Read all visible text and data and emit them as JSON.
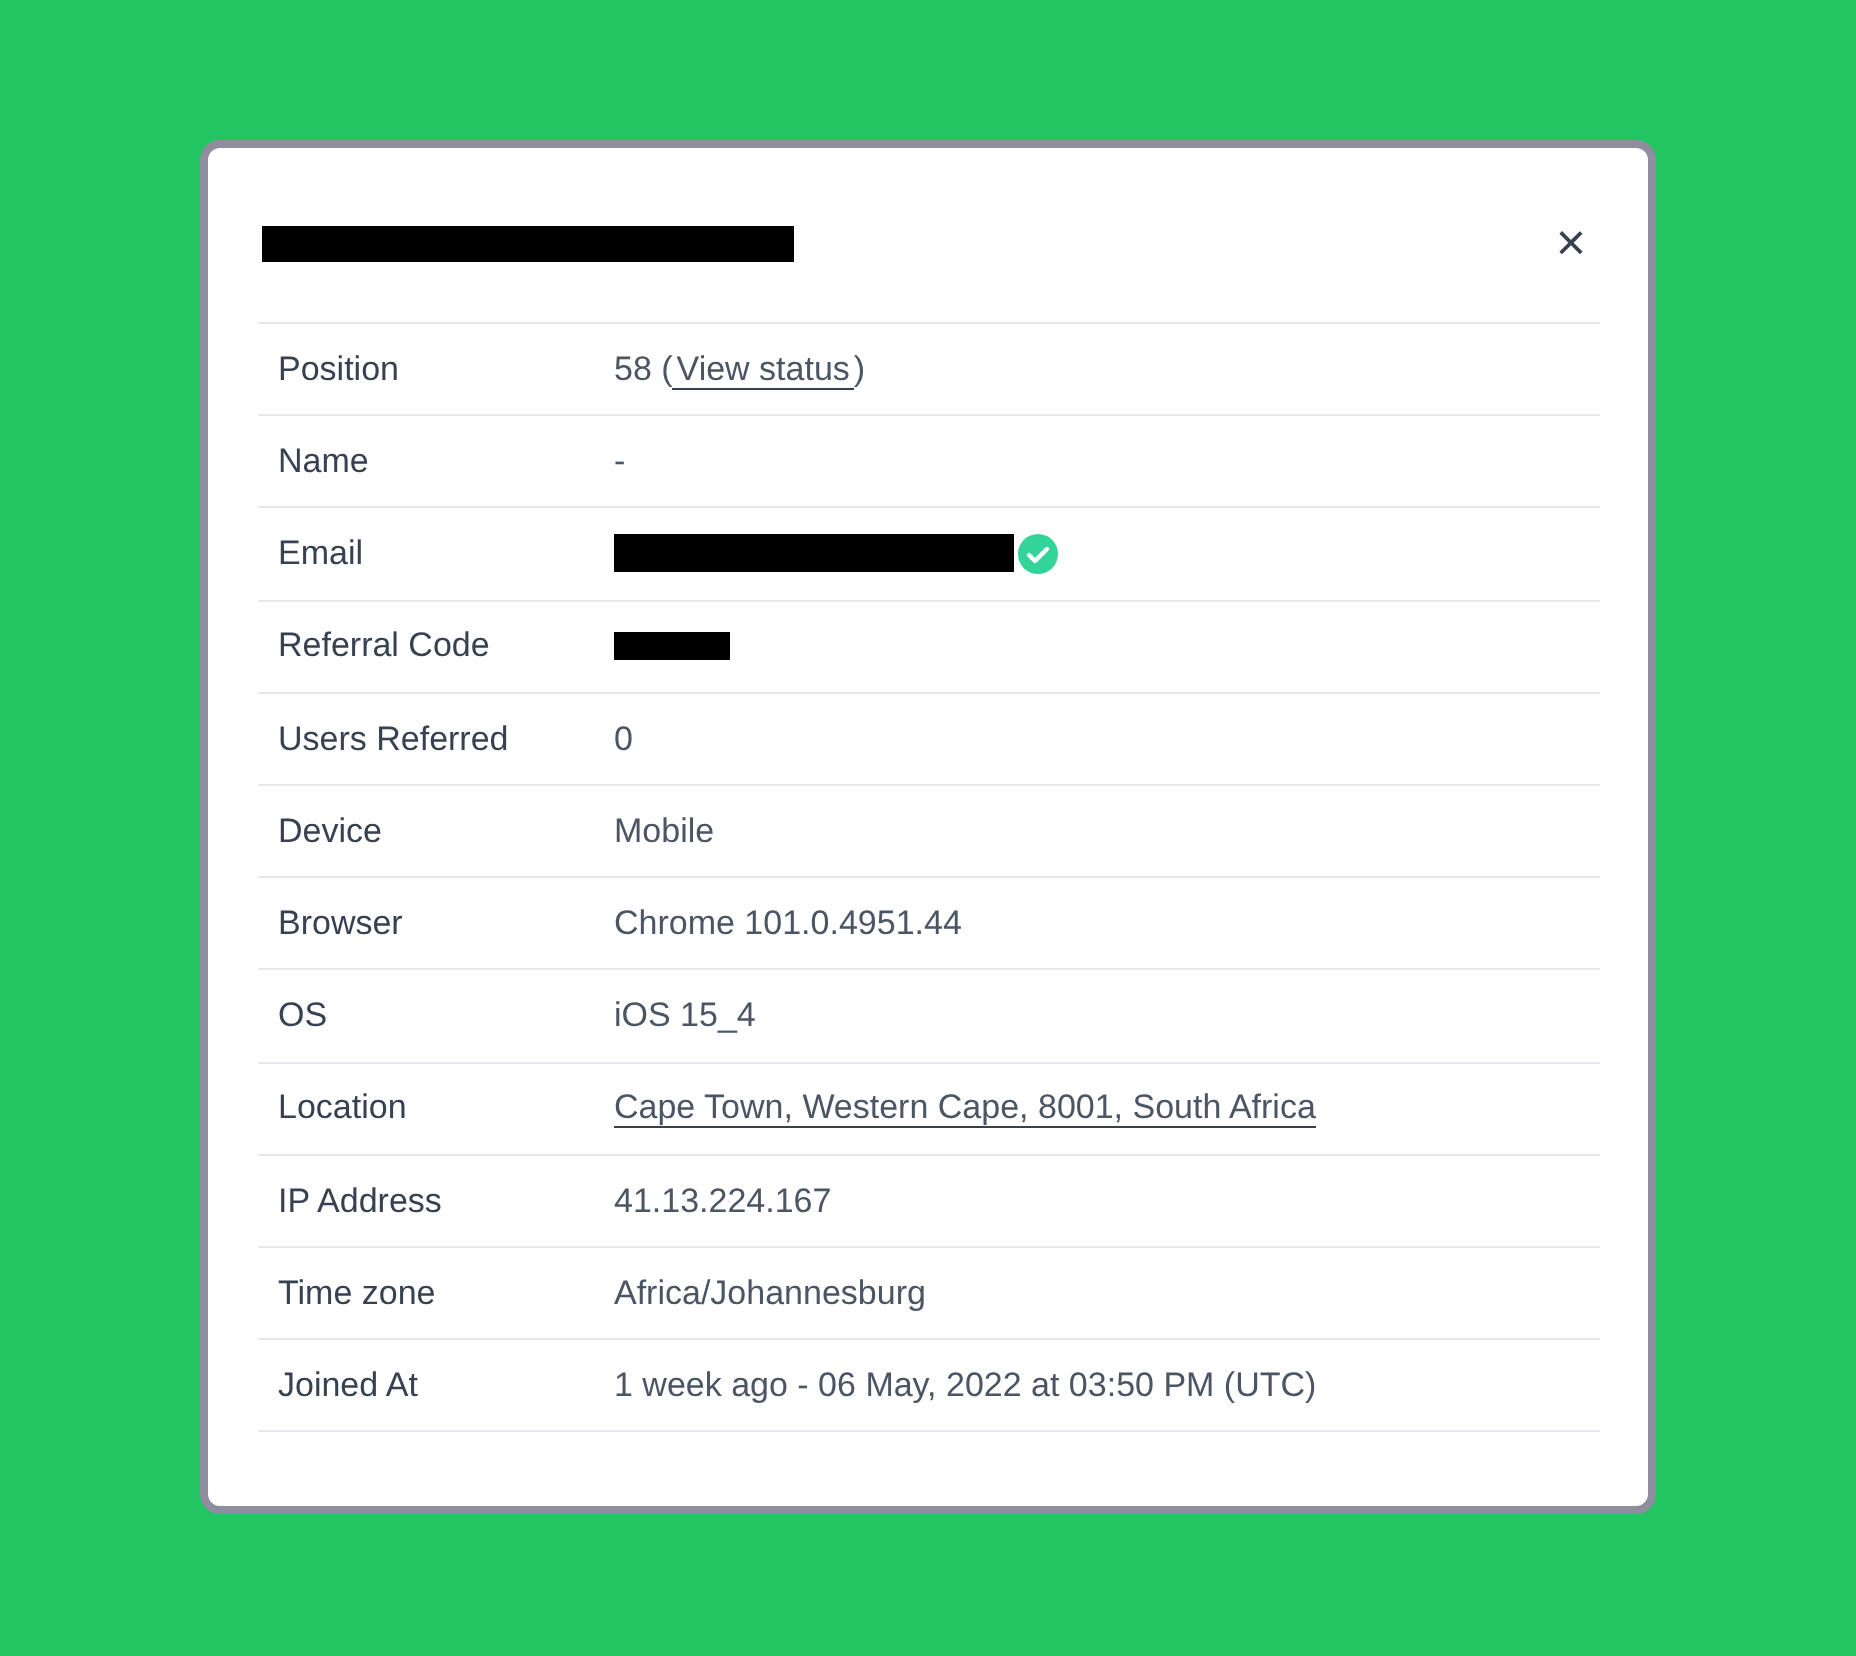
{
  "dialog": {
    "title": {
      "kind": "redacted"
    },
    "close": "×",
    "rows": [
      {
        "label": "Position",
        "kind": "position",
        "prefix": "58 (",
        "link": "View status",
        "suffix": ")"
      },
      {
        "label": "Name",
        "kind": "text",
        "value": "-"
      },
      {
        "label": "Email",
        "kind": "redacted",
        "verified": true
      },
      {
        "label": "Referral Code",
        "kind": "redacted",
        "verified": false
      },
      {
        "label": "Users Referred",
        "kind": "text",
        "value": "0"
      },
      {
        "label": "Device",
        "kind": "text",
        "value": "Mobile"
      },
      {
        "label": "Browser",
        "kind": "text",
        "value": "Chrome 101.0.4951.44"
      },
      {
        "label": "OS",
        "kind": "text",
        "value": "iOS 15_4"
      },
      {
        "label": "Location",
        "kind": "link",
        "value": "Cape Town, Western Cape, 8001, South Africa"
      },
      {
        "label": "IP Address",
        "kind": "text",
        "value": "41.13.224.167"
      },
      {
        "label": "Time zone",
        "kind": "text",
        "value": "Africa/Johannesburg"
      },
      {
        "label": "Joined At",
        "kind": "text",
        "value": "1 week ago - 06 May, 2022 at 03:50 PM (UTC)"
      }
    ]
  }
}
